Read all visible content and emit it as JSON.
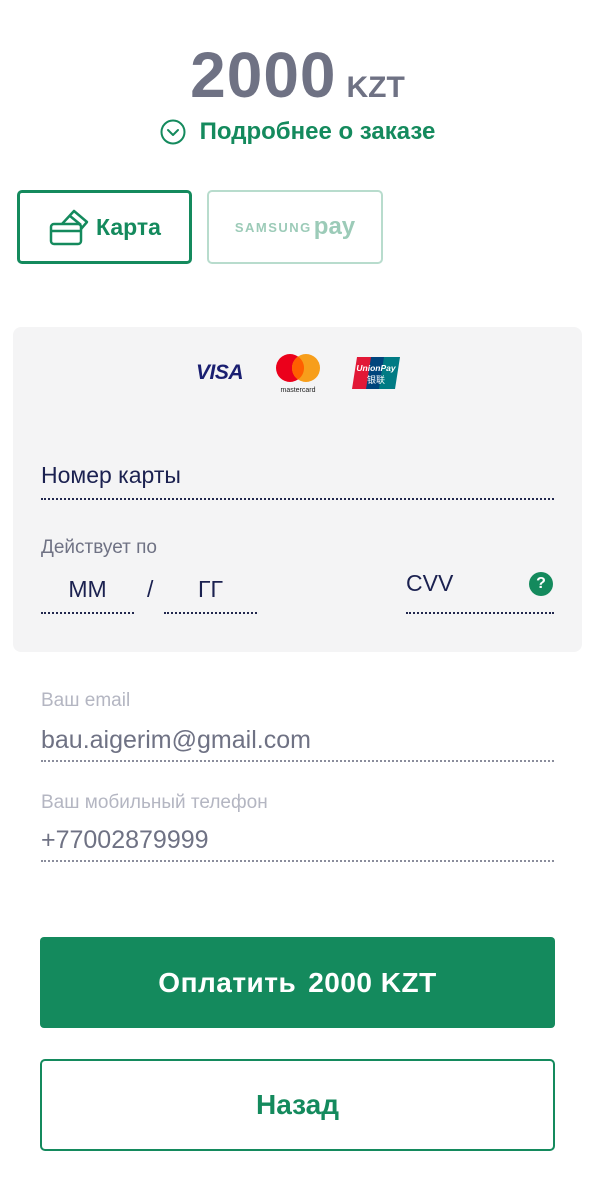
{
  "order": {
    "amount": "2000",
    "currency": "KZT",
    "details_link": "Подробнее о заказе"
  },
  "methods": {
    "card_label": "Карта",
    "samsung_brand": "SAMSUNG",
    "samsung_pay": "pay"
  },
  "card_form": {
    "brands": {
      "visa": "VISA",
      "mastercard": "mastercard",
      "unionpay": "UnionPay",
      "unionpay_cn": "银联"
    },
    "number_placeholder": "Номер карты",
    "expiry_label": "Действует по",
    "month_placeholder": "ММ",
    "separator": "/",
    "year_placeholder": "ГГ",
    "cvv_placeholder": "CVV",
    "help_icon": "?"
  },
  "contact": {
    "email_label": "Ваш email",
    "email_value": "bau.aigerim@gmail.com",
    "phone_label": "Ваш мобильный телефон",
    "phone_value": "+77002879999"
  },
  "actions": {
    "pay_label": "Оплатить",
    "pay_amount": "2000 KZT",
    "back_label": "Назад"
  },
  "colors": {
    "accent": "#148a5d",
    "text_dark": "#1b2150",
    "text_muted": "#6f7284",
    "panel_bg": "#f4f4f5"
  }
}
